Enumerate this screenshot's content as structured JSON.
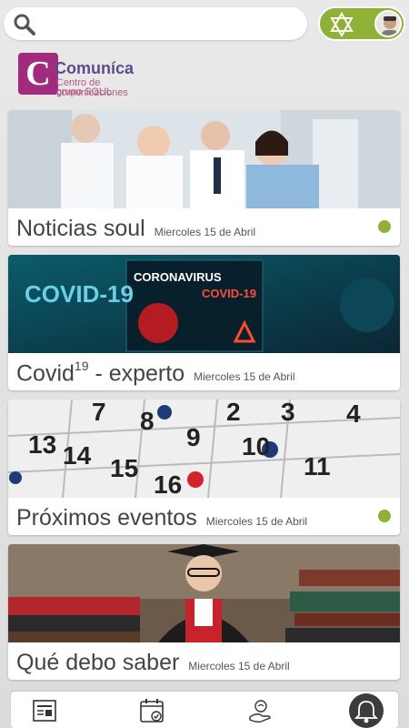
{
  "header": {
    "search_placeholder": "",
    "app_name": "Comuníca",
    "logo_letter": "C",
    "logo_subtitle_line1": "Centro de comunicaciones",
    "logo_subtitle_line2": "grupo SOUL"
  },
  "cards": [
    {
      "title": "Noticias soul",
      "date": "Miercoles 15 de Abril",
      "unread": true
    },
    {
      "title_main": "Covid",
      "title_sup": "19",
      "title_rest": " - experto",
      "date": "Miercoles 15 de Abril",
      "unread": false
    },
    {
      "title": "Próximos eventos",
      "date": "Miercoles 15 de Abril",
      "unread": true
    },
    {
      "title": "Qué debo saber",
      "date": "Miercoles 15 de Abril",
      "unread": false
    }
  ],
  "image_text": {
    "covid": "COVID-19",
    "coronavirus": "CORONAVIRUS",
    "covid19_red": "COVID-19",
    "calendar_numbers": [
      "2",
      "3",
      "4",
      "7",
      "8",
      "9",
      "10",
      "11",
      "13",
      "14",
      "15",
      "16"
    ]
  },
  "colors": {
    "accent_green": "#8fb236",
    "brand_purple": "#a12b7c"
  },
  "icons": [
    "search-icon",
    "star-of-david-icon",
    "newspaper-icon",
    "calendar-check-icon",
    "hand-heart-icon",
    "bell-icon"
  ]
}
